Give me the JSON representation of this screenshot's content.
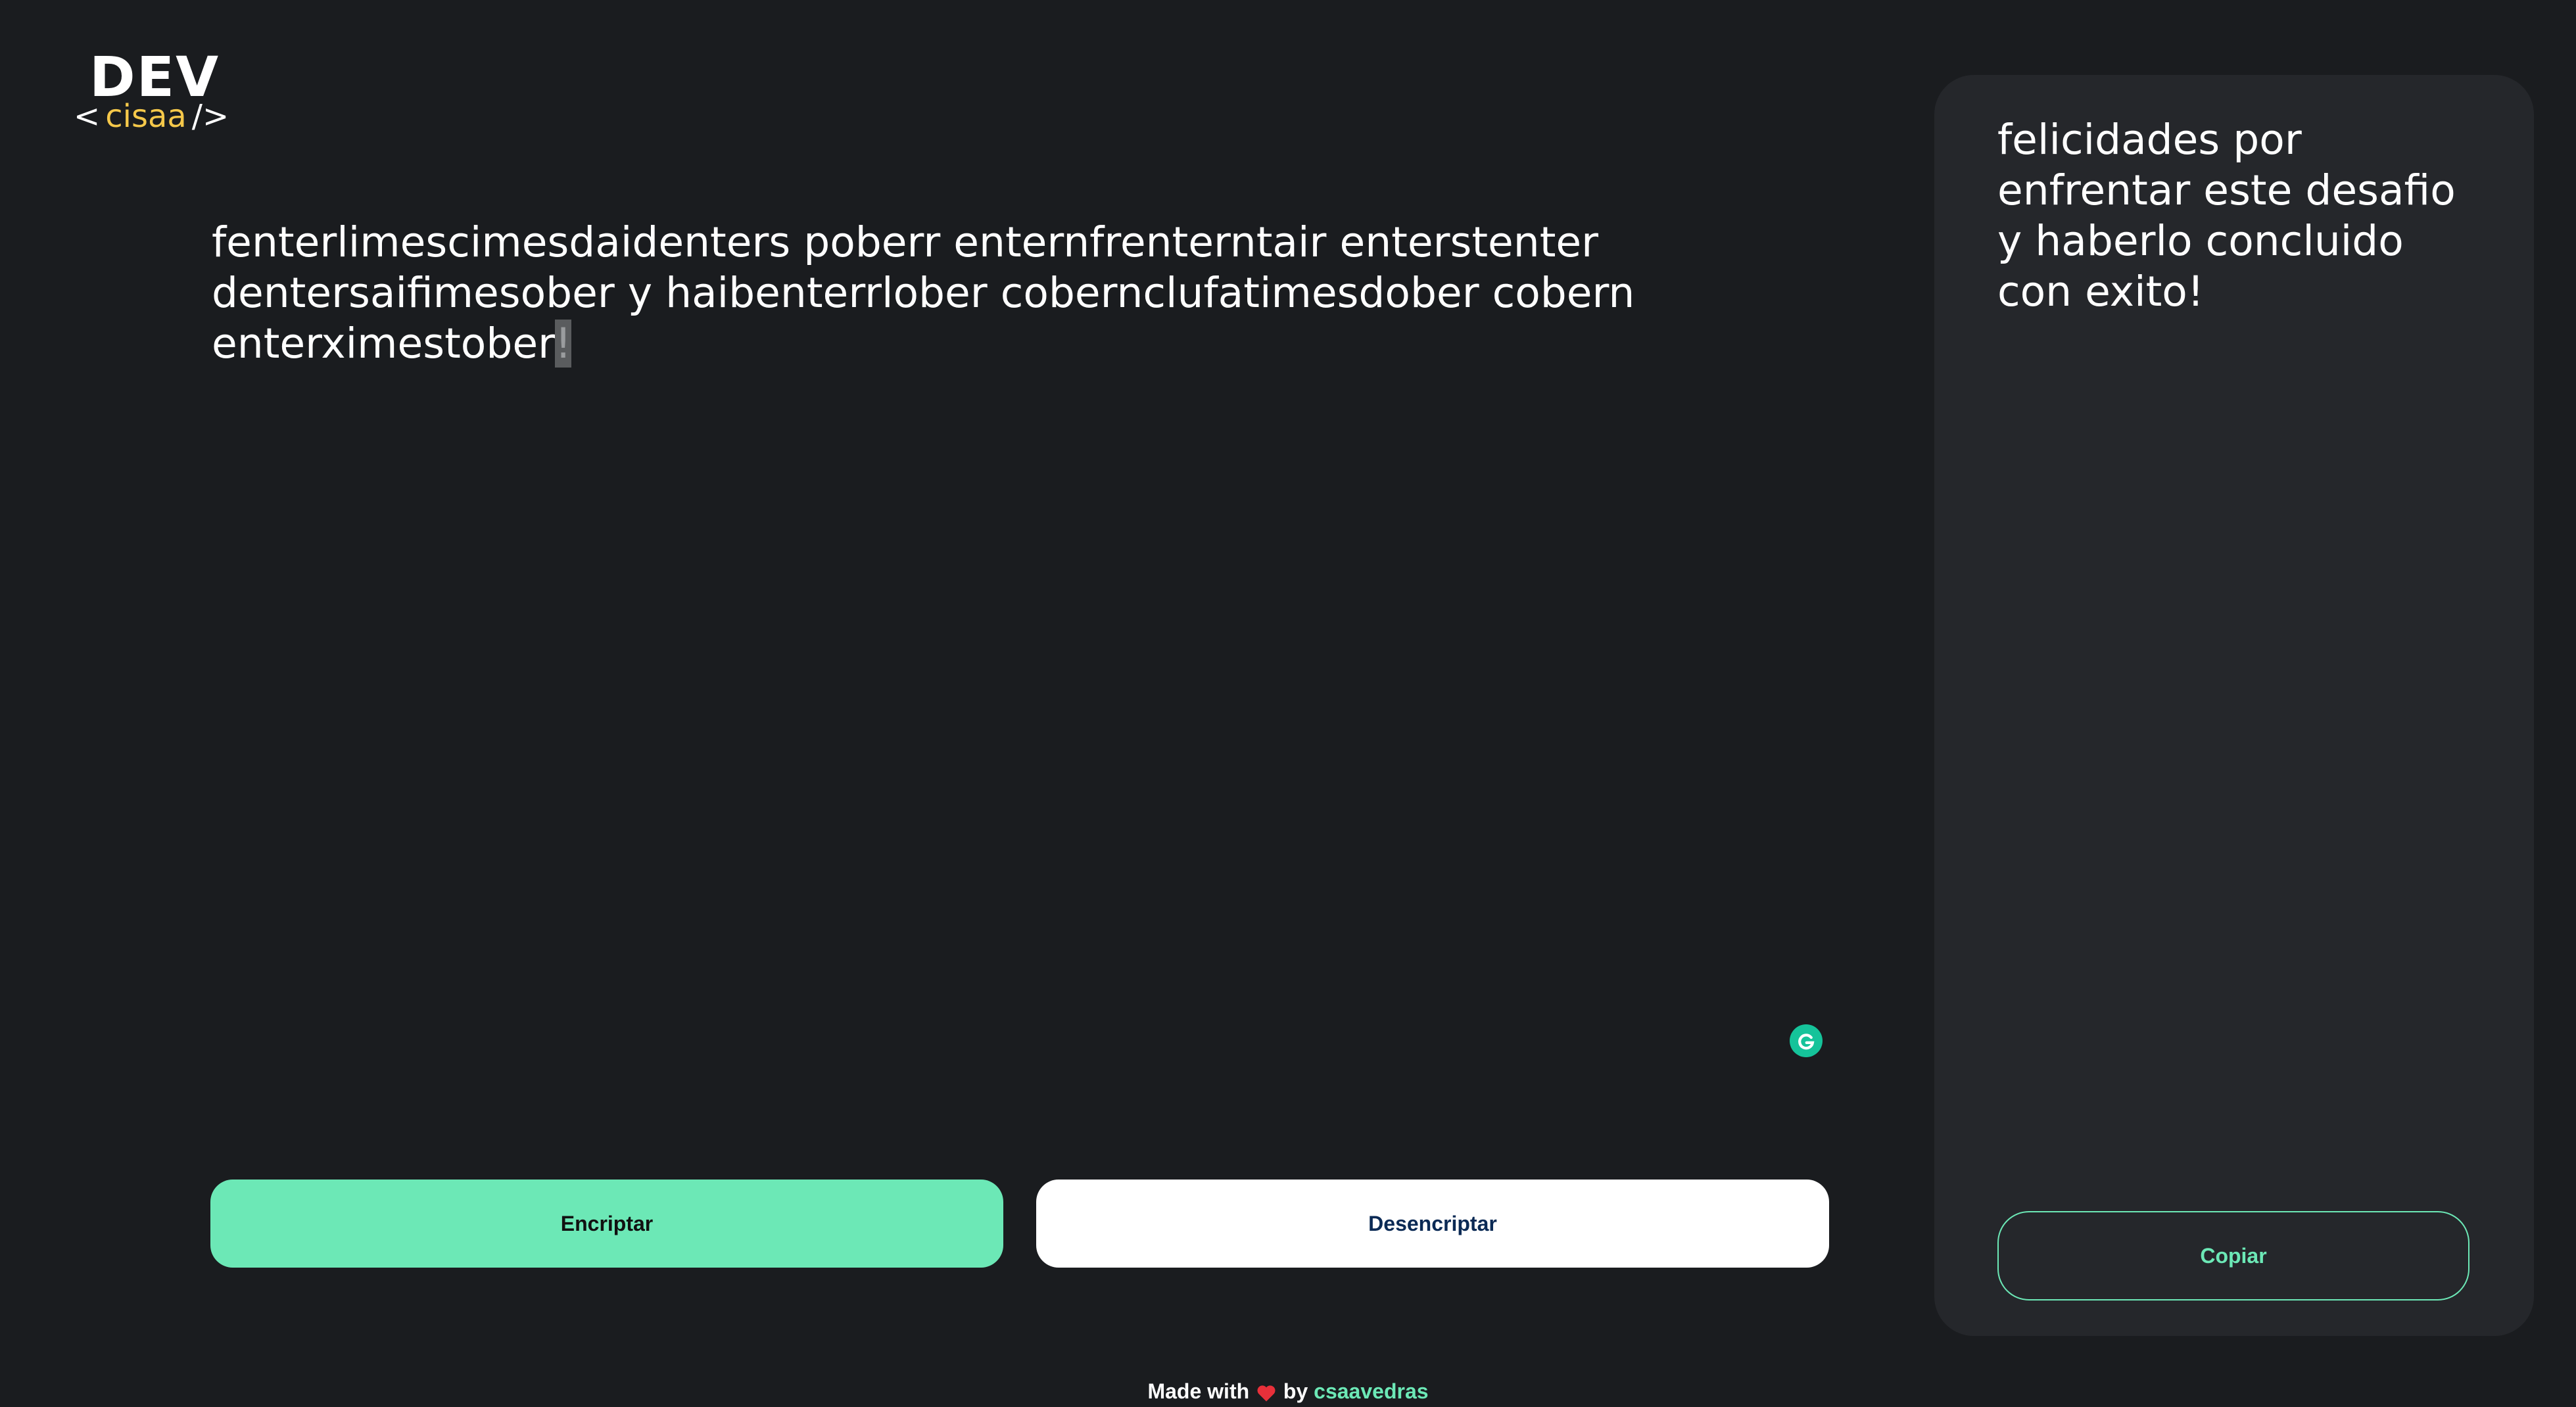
{
  "logo": {
    "title": "DEV",
    "open_tag": "<",
    "name": "cisaa",
    "close_tag": "/>",
    "name_color": "#f5c84a"
  },
  "input": {
    "value_main": "fenterlimescimesdaidenters poberr enternfrenterntair enterstenter dentersaifimesober y haibenterrlober cobernclufatimesdober cobern enterximestober",
    "value_selected": "!"
  },
  "buttons": {
    "encrypt_label": "Encriptar",
    "decrypt_label": "Desencriptar",
    "copy_label": "Copiar"
  },
  "output": {
    "text": "felicidades por enfrentar este desafio y haberlo concluido con exito!"
  },
  "footer": {
    "made_with": "Made with",
    "by": "by",
    "author": "csaavedras"
  },
  "icons": {
    "assist": "grammar-assistant-icon",
    "heart": "heart-icon"
  },
  "colors": {
    "background": "#1a1c1f",
    "panel": "#25272b",
    "accent": "#6ce8b6",
    "decrypt_text": "#0b2a55"
  }
}
